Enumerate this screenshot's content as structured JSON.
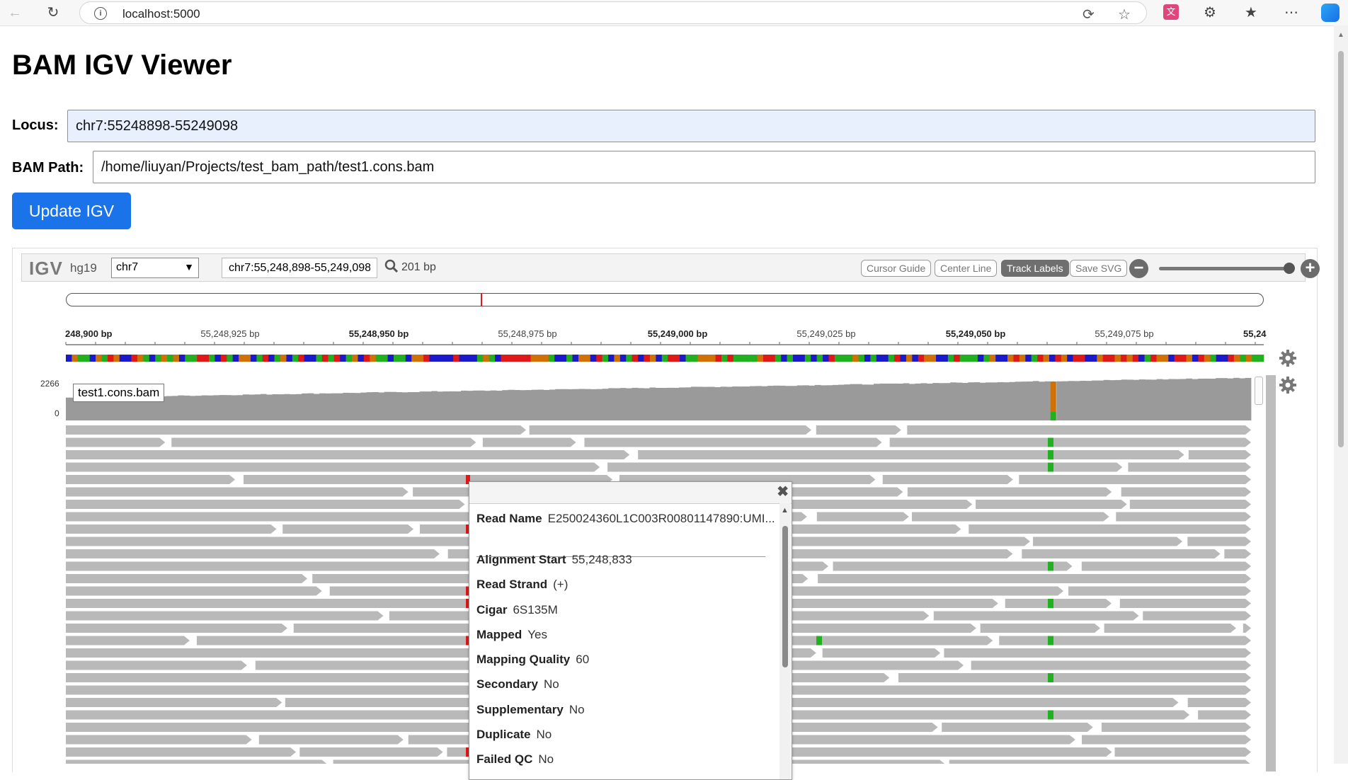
{
  "browser": {
    "url": "localhost:5000"
  },
  "page": {
    "title": "BAM IGV Viewer",
    "locus_label": "Locus:",
    "locus_value": "chr7:55248898-55249098",
    "bam_label": "BAM Path:",
    "bam_value": "/home/liuyan/Projects/test_bam_path/test1.cons.bam",
    "update_button": "Update IGV"
  },
  "igv": {
    "logo": "IGV",
    "genome": "hg19",
    "chromosome": "chr7",
    "locus": "chr7:55,248,898-55,249,098",
    "width_bp": "201 bp",
    "buttons": {
      "cursor_guide": "Cursor Guide",
      "center_line": "Center Line",
      "track_labels": "Track Labels",
      "save_svg": "Save SVG"
    },
    "ruler_ticks": [
      {
        "label": "248,900 bp",
        "major": true
      },
      {
        "label": "55,248,925 bp",
        "major": false
      },
      {
        "label": "55,248,950 bp",
        "major": true
      },
      {
        "label": "55,248,975 bp",
        "major": false
      },
      {
        "label": "55,249,000 bp",
        "major": true
      },
      {
        "label": "55,249,025 bp",
        "major": false
      },
      {
        "label": "55,249,050 bp",
        "major": true
      },
      {
        "label": "55,249,075 bp",
        "major": false
      },
      {
        "label": "55,24",
        "major": true
      }
    ],
    "track_name": "test1.cons.bam",
    "coverage_max": "2266",
    "coverage_min": "0",
    "colors": {
      "A": "#20b020",
      "C": "#1a1acc",
      "G": "#d17105",
      "T": "#e01818",
      "read": "#b9b9b9",
      "coverage": "#9a9a9a"
    }
  },
  "popup": {
    "close_icon": "close-icon",
    "rows": [
      {
        "key": "Read Name",
        "value": "E250024360L1C003R00801147890:UMI..."
      },
      {
        "key": "Alignment Start",
        "value": "55,248,833"
      },
      {
        "key": "Read Strand",
        "value": "(+)"
      },
      {
        "key": "Cigar",
        "value": "6S135M"
      },
      {
        "key": "Mapped",
        "value": "Yes"
      },
      {
        "key": "Mapping Quality",
        "value": "60"
      },
      {
        "key": "Secondary",
        "value": "No"
      },
      {
        "key": "Supplementary",
        "value": "No"
      },
      {
        "key": "Duplicate",
        "value": "No"
      },
      {
        "key": "Failed QC",
        "value": "No"
      }
    ]
  }
}
